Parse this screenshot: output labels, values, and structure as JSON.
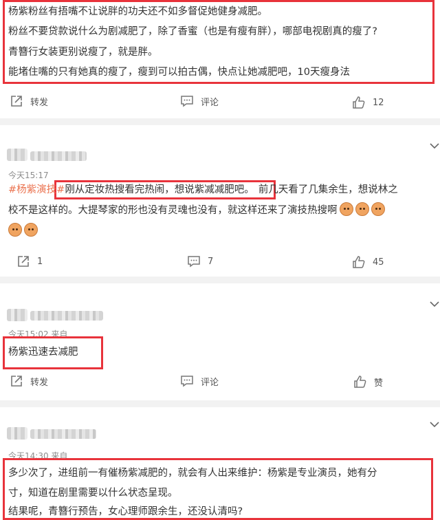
{
  "comment1": {
    "lines": [
      "杨紫粉丝有捂嘴不让说胖的功夫还不如多督促她健身减肥。",
      "粉丝不要贷款说什么为剧减肥了，除了香蜜（也是有瘦有胖），哪部电视剧真的瘦了?",
      "青簪行女装更别说瘦了，就是胖。",
      "能堵住嘴的只有她真的瘦了，瘦到可以拍古偶，快点让她减肥吧，10天瘦身法"
    ],
    "actions": {
      "repost": "转发",
      "comment": "评论",
      "like": "12"
    }
  },
  "comment2": {
    "time": "今天15:17",
    "hashtag": "#杨紫演技#",
    "text_a": "刚从定妆热搜看完热闹，想说紫减减肥吧。",
    "text_b": "前几天看了几集余生，想说林之",
    "line2": "校不是这样的。大提琴家的形也没有灵魂也没有，就这样还来了演技热搜啊",
    "actions": {
      "repost": "1",
      "comment": "7",
      "like": "45"
    }
  },
  "comment3": {
    "time": "今天15:02  来自",
    "text": "杨紫迅速去减肥",
    "actions": {
      "repost": "转发",
      "comment": "评论",
      "like": "赞"
    }
  },
  "comment4": {
    "time": "今天14:30  来自",
    "lines": [
      "多少次了，进组前一有催杨紫减肥的，就会有人出来维护：杨紫是专业演员，她有分",
      "寸，知道在剧里需要以什么状态呈现。",
      "结果呢，青簪行预告，女心理师跟余生，还没认清吗?"
    ]
  },
  "colors": {
    "highlight": "#e8333b",
    "hashtag": "#eb7350",
    "divider": "#f2f2f2"
  }
}
